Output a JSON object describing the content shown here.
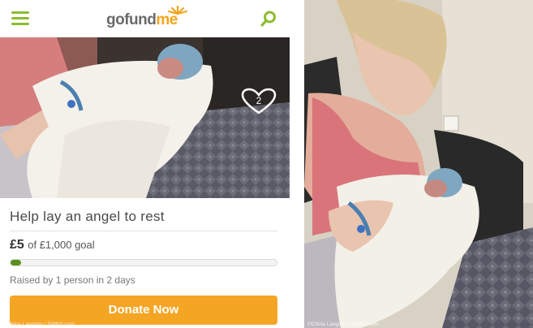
{
  "header": {
    "logo_go": "gofund",
    "logo_me": "me",
    "menu_icon": "hamburger-menu-icon",
    "search_icon": "search-icon"
  },
  "photo": {
    "heart_icon": "heart-icon",
    "heart_count": "2"
  },
  "campaign": {
    "title": "Help lay an angel to rest",
    "raised_amount": "£5",
    "raised_goal": "of £1,000 goal",
    "progress_fraction": 0.005,
    "raised_by": "Raised by 1 person in 2 days",
    "donate_label": "Donate Now"
  },
  "colors": {
    "brand_green": "#8dbb2f",
    "progress_green": "#5a8f1f",
    "donate_orange": "#f5a524"
  },
  "credits": {
    "left": "©China Langdon / SWNS.com",
    "right": "©China Langdon / SWNS.com"
  }
}
